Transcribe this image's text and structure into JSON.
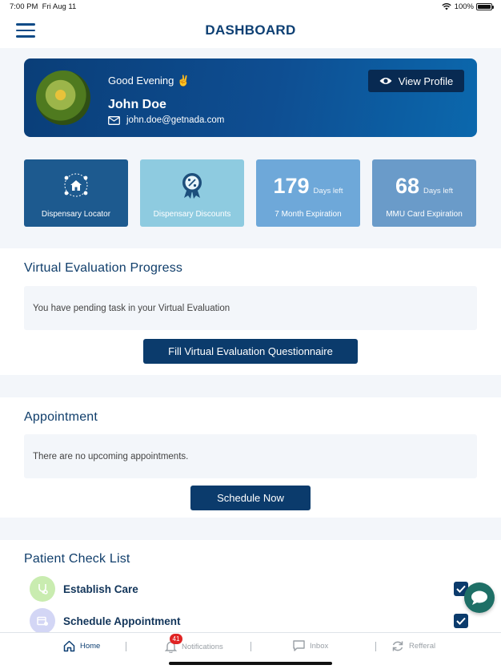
{
  "status_bar": {
    "time": "7:00 PM",
    "date": "Fri Aug 11",
    "battery": "100%"
  },
  "header": {
    "title": "DASHBOARD",
    "menu_icon": "hamburger-menu-icon"
  },
  "profile": {
    "greeting": "Good Evening ✌️",
    "name": "John Doe",
    "email": "john.doe@getnada.com",
    "view_profile_label": "View Profile"
  },
  "tiles": [
    {
      "label": "Dispensary Locator",
      "icon": "dispensary-locator-icon",
      "color": "#1d5a8f"
    },
    {
      "label": "Dispensary Discounts",
      "icon": "discount-badge-icon",
      "color": "#8ecbe0"
    },
    {
      "number": "179",
      "unit": "Days left",
      "label": "7 Month Expiration",
      "color": "#6ea8d9"
    },
    {
      "number": "68",
      "unit": "Days left",
      "label": "MMU Card Expiration",
      "color": "#6a9bc9"
    }
  ],
  "virtual_evaluation": {
    "title": "Virtual Evaluation Progress",
    "message": "You have pending task in your Virtual Evaluation",
    "button_label": "Fill Virtual Evaluation Questionnaire"
  },
  "appointment": {
    "title": "Appointment",
    "message": "There are no upcoming appointments.",
    "button_label": "Schedule Now"
  },
  "checklist": {
    "title": "Patient Check List",
    "items": [
      {
        "label": "Establish Care",
        "checked": true,
        "icon": "stethoscope-icon",
        "color": "#c9ecb0"
      },
      {
        "label": "Schedule Appointment",
        "checked": true,
        "icon": "calendar-icon",
        "color": "#d3d6f5"
      }
    ]
  },
  "tabbar": {
    "items": [
      {
        "label": "Home",
        "icon": "home-icon",
        "active": true
      },
      {
        "label": "Notifications",
        "icon": "bell-icon",
        "badge": "41"
      },
      {
        "label": "Inbox",
        "icon": "chat-icon"
      },
      {
        "label": "Refferal",
        "icon": "refresh-icon"
      }
    ]
  },
  "colors": {
    "primary": "#0b3b6c",
    "accent": "#0e4e92",
    "chat_fab": "#1e6f66"
  }
}
